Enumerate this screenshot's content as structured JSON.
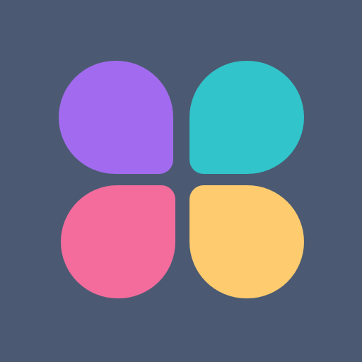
{
  "background_color": "#4b5a72",
  "logo": {
    "icon": "four-petal-logo-icon",
    "petals": [
      {
        "position": "top-left",
        "color": "#a26bef"
      },
      {
        "position": "top-right",
        "color": "#31c4cb"
      },
      {
        "position": "bottom-left",
        "color": "#f36c9c"
      },
      {
        "position": "bottom-right",
        "color": "#fecb6e"
      }
    ]
  }
}
